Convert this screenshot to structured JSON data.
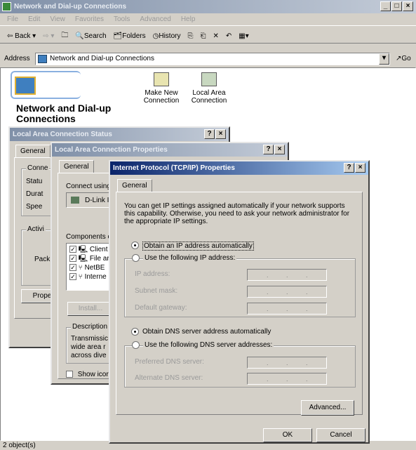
{
  "explorer": {
    "title": "Network and Dial-up Connections",
    "menu": [
      "File",
      "Edit",
      "View",
      "Favorites",
      "Tools",
      "Advanced",
      "Help"
    ],
    "toolbar": {
      "back": "Back",
      "search": "Search",
      "folders": "Folders",
      "history": "History"
    },
    "address_label": "Address",
    "address_value": "Network and Dial-up Connections",
    "go": "Go",
    "folder_title": "Network and Dial-up Connections",
    "icons": [
      {
        "label": "Make New Connection",
        "icon": "make-new-connection-icon"
      },
      {
        "label": "Local Area Connection",
        "icon": "local-area-connection-icon"
      }
    ],
    "status": "2 object(s)"
  },
  "status_dialog": {
    "title": "Local Area Connection Status",
    "tab": "General",
    "group_connection": "Conne",
    "rows": [
      "Statu",
      "Durat",
      "Spee"
    ],
    "group_activity": "Activi",
    "packets": "Pack",
    "properties_btn": "Prope"
  },
  "props_dialog": {
    "title": "Local Area Connection Properties",
    "tab": "General",
    "connect_using": "Connect using",
    "adapter": "D-Link I",
    "components_label": "Components c",
    "components": [
      "Client",
      "File ar",
      "NetBE",
      "Interne"
    ],
    "install_btn": "Install...",
    "description_label": "Description",
    "description_lines": [
      "Transmissic",
      "wide area r",
      "across dive"
    ],
    "show_icon": "Show icor"
  },
  "tcpip_dialog": {
    "title": "Internet Protocol (TCP/IP) Properties",
    "tab": "General",
    "intro": "You can get IP settings assigned automatically if your network supports this capability. Otherwise, you need to ask your network administrator for the appropriate IP settings.",
    "obtain_ip_auto": "Obtain an IP address automatically",
    "use_following_ip": "Use the following IP address:",
    "ip_fields": [
      "IP address:",
      "Subnet mask:",
      "Default gateway:"
    ],
    "obtain_dns_auto": "Obtain DNS server address automatically",
    "use_following_dns": "Use the following DNS server addresses:",
    "dns_fields": [
      "Preferred DNS server:",
      "Alternate DNS server:"
    ],
    "advanced_btn": "Advanced...",
    "ok_btn": "OK",
    "cancel_btn": "Cancel"
  },
  "colors": {
    "active_title": "#2f5aa8",
    "inactive_title": "#8090a8",
    "dialog_face": "#d4d0c8"
  }
}
